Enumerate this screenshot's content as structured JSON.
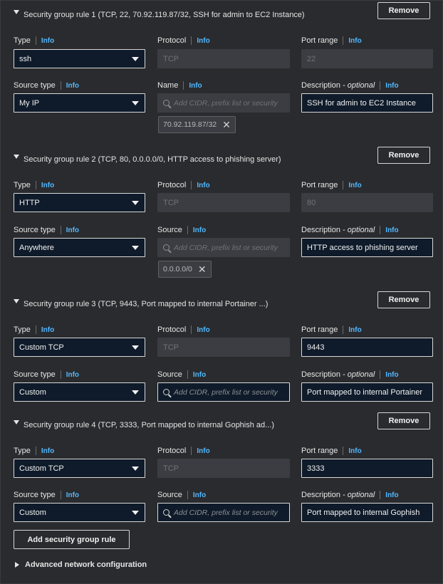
{
  "info_label": "Info",
  "labels": {
    "type": "Type",
    "protocol": "Protocol",
    "port_range": "Port range",
    "source_type": "Source type",
    "name": "Name",
    "source": "Source",
    "description": "Description",
    "optional": "- optional"
  },
  "remove_label": "Remove",
  "search_placeholder": "Add CIDR, prefix list or security",
  "rules": [
    {
      "title": "Security group rule 1 (TCP, 22, 70.92.119.87/32, SSH for admin to EC2 Instance)",
      "type": "ssh",
      "protocol": "TCP",
      "port_range": "22",
      "source_type": "My IP",
      "description": "SSH for admin to EC2 Instance",
      "token": "70.92.119.87/32"
    },
    {
      "title": "Security group rule 2 (TCP, 80, 0.0.0.0/0, HTTP access to phishing server)",
      "type": "HTTP",
      "protocol": "TCP",
      "port_range": "80",
      "source_type": "Anywhere",
      "description": "HTTP access to phishing server",
      "token": "0.0.0.0/0"
    },
    {
      "title": "Security group rule 3 (TCP, 9443, Port mapped to internal Portainer ...)",
      "type": "Custom TCP",
      "protocol": "TCP",
      "port_range": "9443",
      "source_type": "Custom",
      "description": "Port mapped to internal Portainer"
    },
    {
      "title": "Security group rule 4 (TCP, 3333, Port mapped to internal Gophish ad...)",
      "type": "Custom TCP",
      "protocol": "TCP",
      "port_range": "3333",
      "source_type": "Custom",
      "description": "Port mapped to internal Gophish"
    }
  ],
  "add_rule_label": "Add security group rule",
  "advanced_label": "Advanced network configuration",
  "colors": {
    "info": "#53b8ff",
    "input_bg": "#0f1b2a",
    "panel_bg": "#2a2b2e"
  }
}
